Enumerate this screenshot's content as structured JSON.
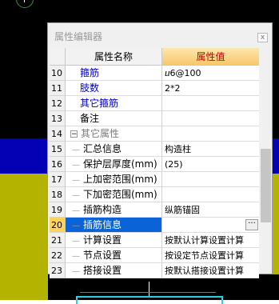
{
  "dialog": {
    "title": "属性编辑器",
    "close_label": "x",
    "columns": {
      "name": "属性名称",
      "value": "属性值"
    }
  },
  "rows": [
    {
      "num": "10",
      "name": "箍筋",
      "value": "ⴎ6@100",
      "blue": true
    },
    {
      "num": "11",
      "name": "肢数",
      "value": "2*2",
      "blue": true
    },
    {
      "num": "12",
      "name": "其它箍筋",
      "value": "",
      "blue": true
    },
    {
      "num": "13",
      "name": "备注",
      "value": ""
    },
    {
      "num": "14",
      "name": "其它属性",
      "value": "",
      "group": true
    },
    {
      "num": "15",
      "name": "汇总信息",
      "value": "构造柱"
    },
    {
      "num": "16",
      "name": "保护层厚度(mm)",
      "value": "(25)"
    },
    {
      "num": "17",
      "name": "上加密范围(mm)",
      "value": ""
    },
    {
      "num": "18",
      "name": "下加密范围(mm)",
      "value": ""
    },
    {
      "num": "19",
      "name": "插筋构造",
      "value": "纵筋锚固"
    },
    {
      "num": "20",
      "name": "插筋信息",
      "value": "",
      "selected": true
    },
    {
      "num": "21",
      "name": "计算设置",
      "value": "按默认计算设置计算"
    },
    {
      "num": "22",
      "name": "节点设置",
      "value": "按设定节点设置计算"
    },
    {
      "num": "23",
      "name": "搭接设置",
      "value": "按默认搭接设置计算"
    }
  ],
  "icons": {
    "collapse": "minus-box-icon",
    "ellipsis": "ellipsis-icon"
  },
  "colors": {
    "selected_row": "#0a64d8",
    "header_value_text": "#c00000",
    "link_text": "#0000c8"
  }
}
